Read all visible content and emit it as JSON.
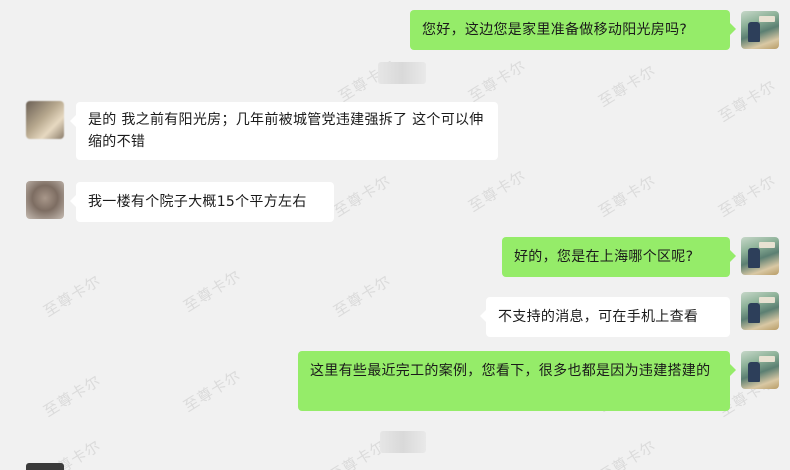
{
  "watermark": "至尊卡尔",
  "messages": [
    {
      "side": "right",
      "text": "您好，这边您是家里准备做移动阳光房吗?"
    },
    {
      "side": "left",
      "text": "是的 我之前有阳光房；几年前被城管党违建强拆了 这个可以伸缩的不错"
    },
    {
      "side": "left",
      "text": "我一楼有个院子大概15个平方左右"
    },
    {
      "side": "right",
      "text": "好的，您是在上海哪个区呢?"
    },
    {
      "side": "right",
      "text": "不支持的消息，可在手机上查看"
    },
    {
      "side": "right",
      "text": "这里有些最近完工的案例，您看下，很多也都是因为违建搭建的"
    }
  ],
  "colors": {
    "background": "#f1f1f1",
    "bubble_self": "#95ec69",
    "bubble_other": "#ffffff"
  }
}
